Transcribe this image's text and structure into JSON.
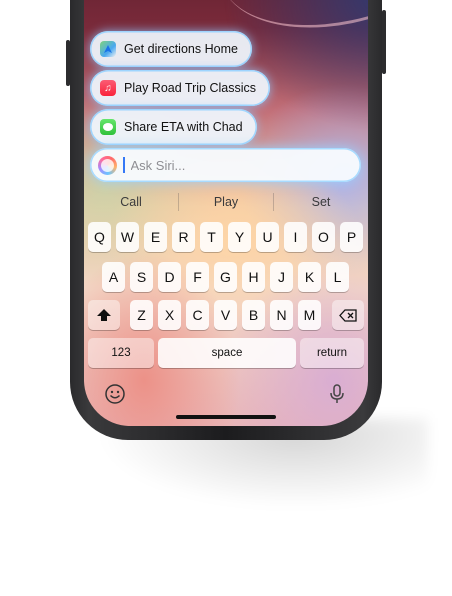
{
  "suggestions": [
    {
      "label": "Get directions Home",
      "icon": "maps-icon"
    },
    {
      "label": "Play Road Trip Classics",
      "icon": "music-icon"
    },
    {
      "label": "Share ETA with Chad",
      "icon": "messages-icon"
    }
  ],
  "siri": {
    "placeholder": "Ask Siri..."
  },
  "predictive": [
    "Call",
    "Play",
    "Set"
  ],
  "keyboard": {
    "row1": [
      "Q",
      "W",
      "E",
      "R",
      "T",
      "Y",
      "U",
      "I",
      "O",
      "P"
    ],
    "row2": [
      "A",
      "S",
      "D",
      "F",
      "G",
      "H",
      "J",
      "K",
      "L"
    ],
    "row3": [
      "Z",
      "X",
      "C",
      "V",
      "B",
      "N",
      "M"
    ],
    "numbers_label": "123",
    "space_label": "space",
    "return_label": "return"
  }
}
